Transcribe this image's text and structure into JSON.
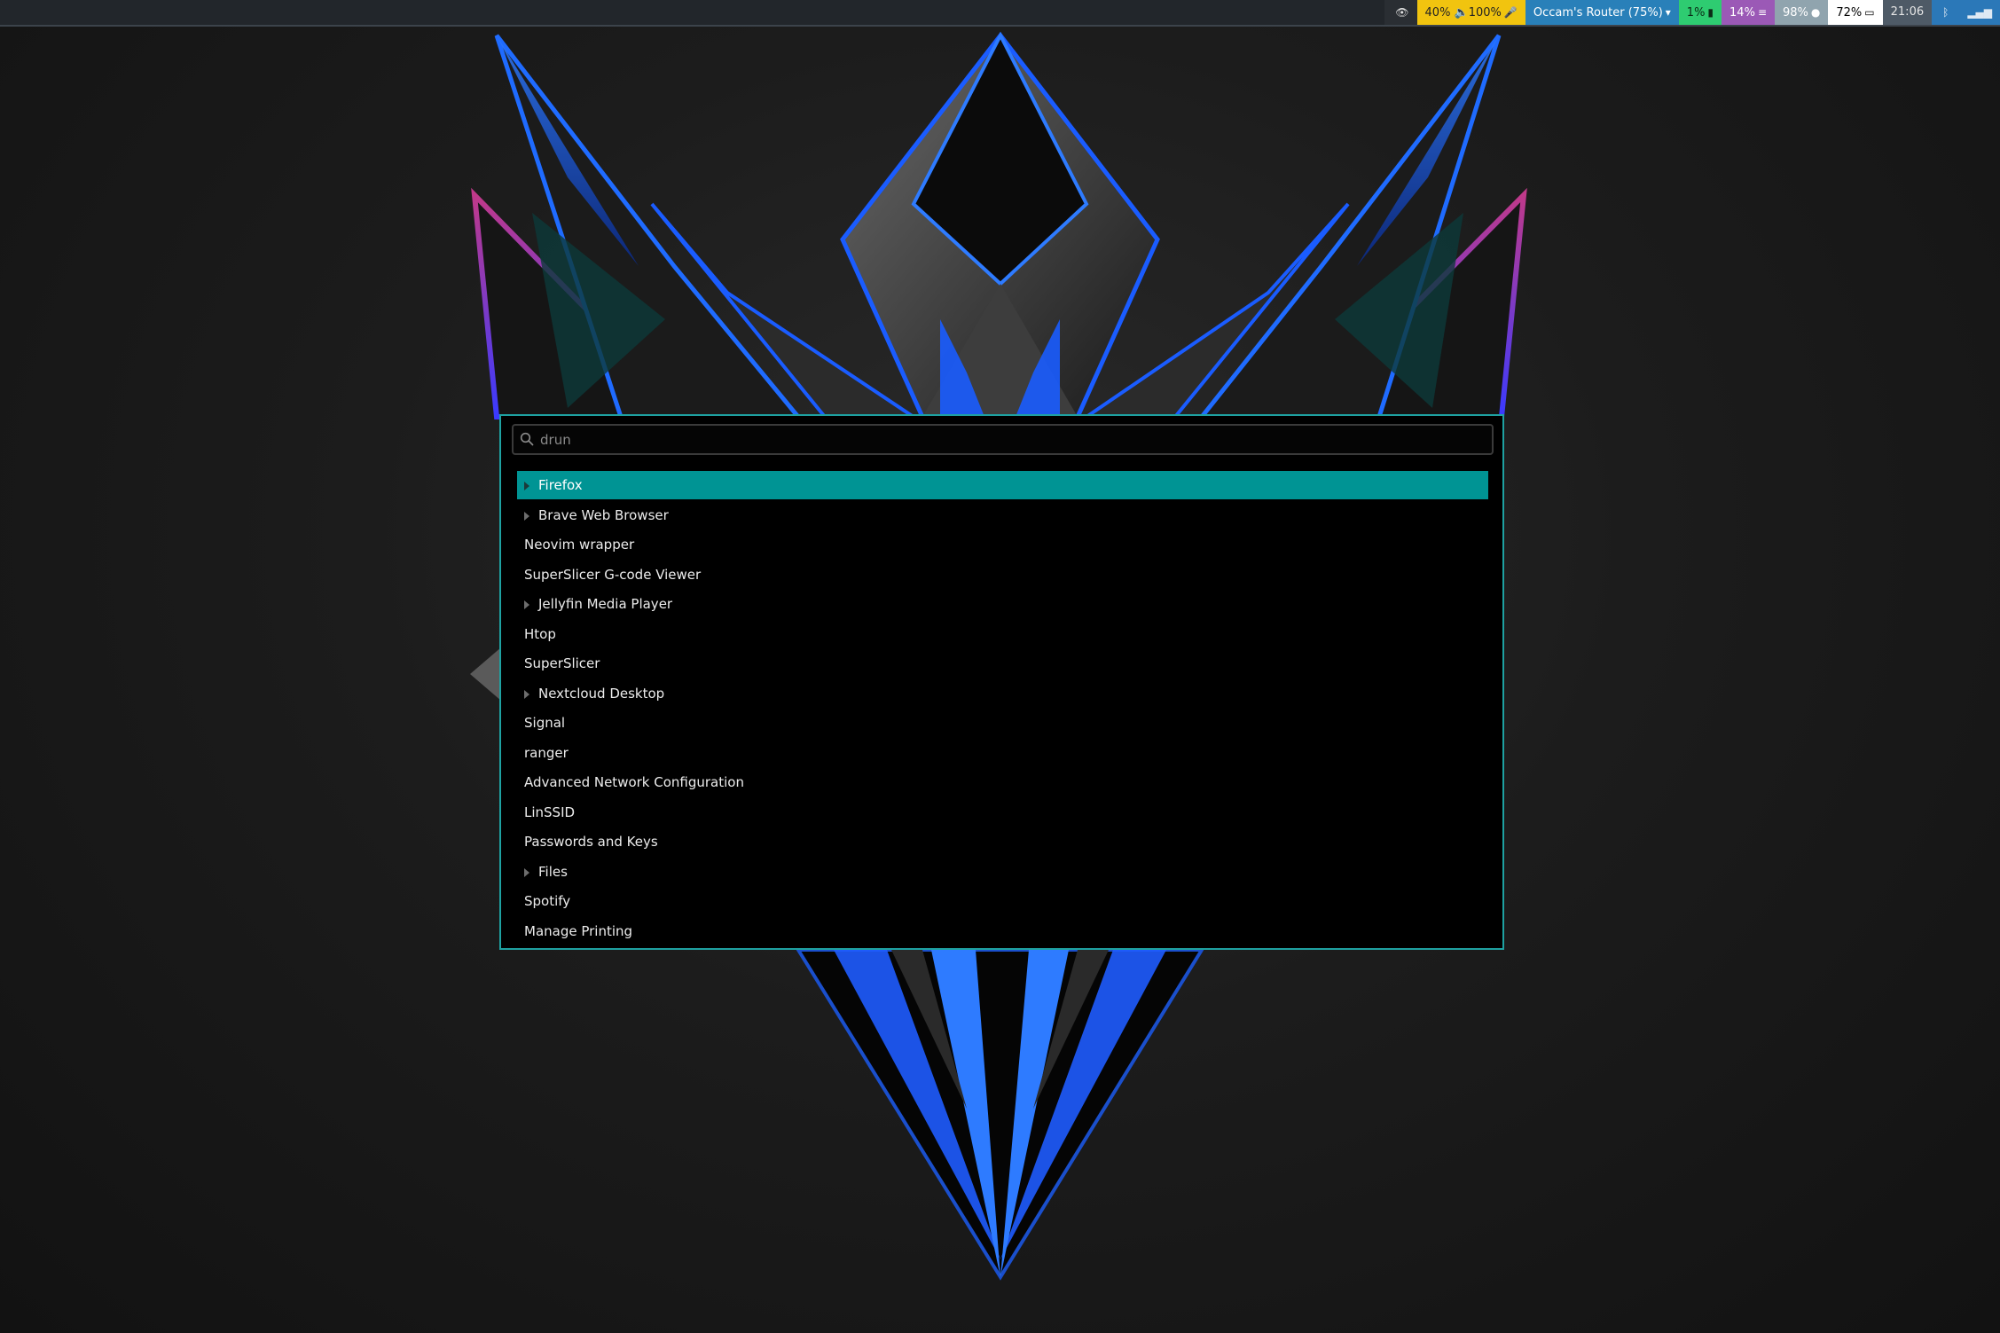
{
  "statusbar": {
    "modules": [
      {
        "name": "idle-inhibitor",
        "text": "",
        "icon": "eye-icon",
        "glyph": "👁",
        "bg": "#2a2e33",
        "fg": "#dddddd"
      },
      {
        "name": "audio",
        "text": "40% 🔈100%",
        "icon": "microphone-icon",
        "glyph": "🎤",
        "bg": "#f1c40f",
        "fg": "#222222"
      },
      {
        "name": "network",
        "text": "Occam's Router (75%)",
        "icon": "wifi-icon",
        "glyph": "▾",
        "bg": "#2980b9",
        "fg": "#ffffff"
      },
      {
        "name": "cpu",
        "text": "1%",
        "icon": "cpu-icon",
        "glyph": "▮",
        "bg": "#2ecc71",
        "fg": "#0b2b16"
      },
      {
        "name": "memory",
        "text": "14%",
        "icon": "memory-icon",
        "glyph": "≡",
        "bg": "#9b59b6",
        "fg": "#ffffff"
      },
      {
        "name": "disk",
        "text": "98%",
        "icon": "disk-icon",
        "glyph": "●",
        "bg": "#90a4ae",
        "fg": "#ffffff"
      },
      {
        "name": "battery",
        "text": "72%",
        "icon": "battery-icon",
        "glyph": "▭",
        "bg": "#ffffff",
        "fg": "#000000"
      },
      {
        "name": "clock",
        "text": "21:06",
        "icon": "",
        "glyph": "",
        "bg": "#4e5a66",
        "fg": "#e6e6e6"
      },
      {
        "name": "bluetooth",
        "text": "",
        "icon": "bluetooth-icon",
        "glyph": "ᛒ",
        "bg": "#2b78b8",
        "fg": "#dfe9f3"
      },
      {
        "name": "signal",
        "text": "",
        "icon": "signal-icon",
        "glyph": "▂▄▆",
        "bg": "#2b78b8",
        "fg": "#dfe9f3"
      }
    ]
  },
  "launcher": {
    "search": {
      "placeholder": "drun",
      "value": ""
    },
    "items": [
      {
        "label": "Firefox",
        "arrow": true,
        "selected": true
      },
      {
        "label": "Brave Web Browser",
        "arrow": true,
        "selected": false
      },
      {
        "label": "Neovim wrapper",
        "arrow": false,
        "selected": false
      },
      {
        "label": "SuperSlicer G-code Viewer",
        "arrow": false,
        "selected": false
      },
      {
        "label": "Jellyfin Media Player",
        "arrow": true,
        "selected": false
      },
      {
        "label": "Htop",
        "arrow": false,
        "selected": false
      },
      {
        "label": "SuperSlicer",
        "arrow": false,
        "selected": false
      },
      {
        "label": "Nextcloud Desktop",
        "arrow": true,
        "selected": false
      },
      {
        "label": "Signal",
        "arrow": false,
        "selected": false
      },
      {
        "label": "ranger",
        "arrow": false,
        "selected": false
      },
      {
        "label": "Advanced Network Configuration",
        "arrow": false,
        "selected": false
      },
      {
        "label": "LinSSID",
        "arrow": false,
        "selected": false
      },
      {
        "label": "Passwords and Keys",
        "arrow": false,
        "selected": false
      },
      {
        "label": "Files",
        "arrow": true,
        "selected": false
      },
      {
        "label": "Spotify",
        "arrow": false,
        "selected": false
      },
      {
        "label": "Manage Printing",
        "arrow": false,
        "selected": false
      }
    ]
  },
  "colors": {
    "accent": "#009494",
    "launcher_border": "#1ea1a1",
    "wallpaper_blue": "#1a5cff"
  }
}
